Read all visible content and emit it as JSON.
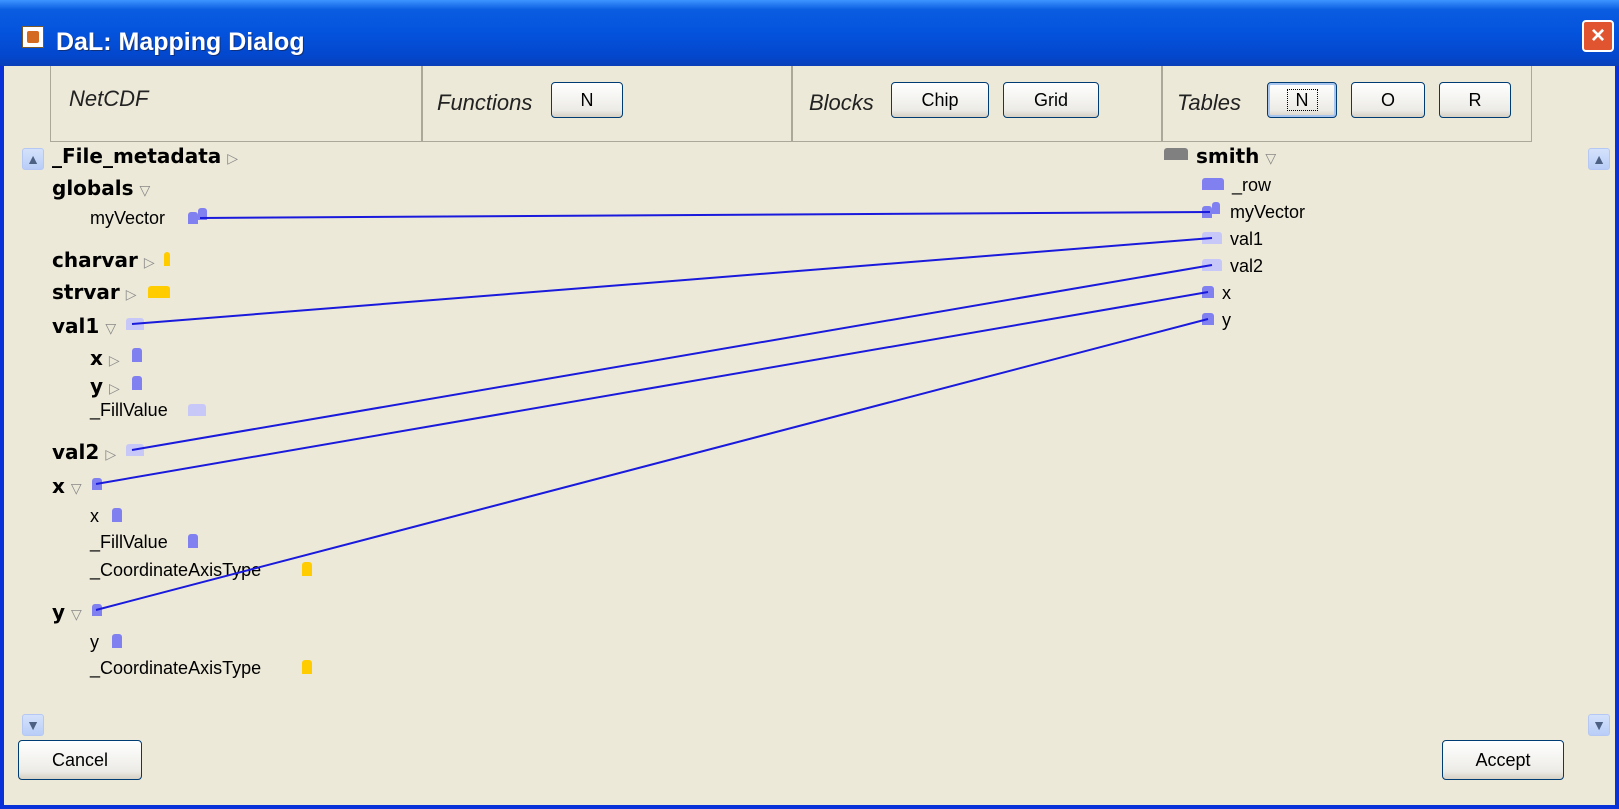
{
  "window": {
    "title": "DaL: Mapping Dialog",
    "close_label": "×"
  },
  "toolbar": {
    "netcdf_label": "NetCDF",
    "functions_label": "Functions",
    "functions_buttons": [
      "N"
    ],
    "blocks_label": "Blocks",
    "blocks_buttons": [
      "Chip",
      "Grid"
    ],
    "tables_label": "Tables",
    "tables_buttons": [
      "N",
      "O",
      "R"
    ]
  },
  "left_tree": [
    {
      "label": "_File_metadata",
      "bold": true,
      "arrow": "▷"
    },
    {
      "label": "globals",
      "bold": true,
      "arrow": "▽"
    },
    {
      "label": "myVector",
      "bold": false
    },
    {
      "label": "charvar",
      "bold": true,
      "arrow": "▷"
    },
    {
      "label": "strvar",
      "bold": true,
      "arrow": "▷"
    },
    {
      "label": "val1",
      "bold": true,
      "arrow": "▽"
    },
    {
      "label": "x",
      "bold": true,
      "arrow": "▷"
    },
    {
      "label": "y",
      "bold": true,
      "arrow": "▷"
    },
    {
      "label": "_FillValue",
      "bold": false
    },
    {
      "label": "val2",
      "bold": true,
      "arrow": "▷"
    },
    {
      "label": "x",
      "bold": true,
      "arrow": "▽"
    },
    {
      "label": "x",
      "bold": false
    },
    {
      "label": "_FillValue",
      "bold": false
    },
    {
      "label": "_CoordinateAxisType",
      "bold": false
    },
    {
      "label": "y",
      "bold": true,
      "arrow": "▽"
    },
    {
      "label": "y",
      "bold": false
    },
    {
      "label": "_CoordinateAxisType",
      "bold": false
    }
  ],
  "right_tree": {
    "root": {
      "label": "smith",
      "arrow": "▽"
    },
    "children": [
      "_row",
      "myVector",
      "val1",
      "val2",
      "x",
      "y"
    ]
  },
  "buttons": {
    "cancel": "Cancel",
    "accept": "Accept"
  },
  "colors": {
    "link": "#1a1adc",
    "tag_blue": "#8080f0",
    "tag_light": "#c8c8f8",
    "tag_yellow": "#ffcc00"
  }
}
